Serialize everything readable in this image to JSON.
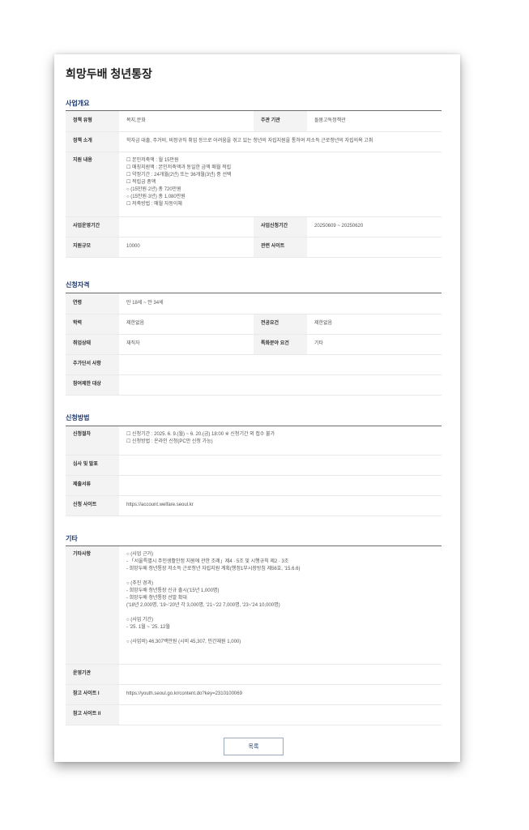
{
  "page_title": "희망두배 청년통장",
  "overview": {
    "heading": "사업개요",
    "policy_type_label": "정책 유형",
    "policy_type_value": "복지,문화",
    "agency_label": "주관 기관",
    "agency_value": "돌봄고독정책관",
    "intro_label": "정책 소개",
    "intro_value": "학자금 대출, 주거비, 비정규직 취업 등으로 어려움을 겪고 있는 청년의 자립지원을 통하여 저소득 근로청년의 자립의욕 고취",
    "support_label": "지원 내용",
    "support_value": "☐ 본인저축액 : 월 15만원\n☐ 매칭지원액 : 본인저축액과 동일한 금액 매월 적립\n☐ 약정기간 : 24개월(2년) 또는 36개월(3년) 중 선택\n☐ 적립금 총액\n○ (15만원·2년) 총 720만원\n○ (15만원·3년) 총 1,080만원\n☐ 저축방법 : 매월 자동이체",
    "op_period_label": "사업운영기간",
    "op_period_value": "",
    "apply_period_label": "사업신청기간",
    "apply_period_value": "20250609 ~ 20250620",
    "scale_label": "지원규모",
    "scale_value": "10000",
    "site_label": "관련 사이트",
    "site_value": ""
  },
  "eligibility": {
    "heading": "신청자격",
    "age_label": "연령",
    "age_value": "만 18세 ~ 만 34세",
    "edu_label": "학력",
    "edu_value": "제한없음",
    "major_label": "전공요건",
    "major_value": "제한없음",
    "job_label": "취업상태",
    "job_value": "재직자",
    "special_label": "특화분야 요건",
    "special_value": "기타",
    "extra_label": "추가단서 사항",
    "extra_value": "",
    "limit_label": "참여제한 대상",
    "limit_value": ""
  },
  "apply_method": {
    "heading": "신청방법",
    "procedure_label": "신청절차",
    "procedure_value": "☐ 신청기간 : 2025. 6. 9.(월) ~ 6. 20.(금) 18:00 ※ 신청기간 외 접수 불가\n☐ 신청방법 : 온라인 신청(PC만 신청 가능)",
    "review_label": "심사 및 발표",
    "review_value": "",
    "docs_label": "제출서류",
    "docs_value": "",
    "site_label": "신청 사이트",
    "site_value": "https://account.welfare.seoul.kr"
  },
  "etc": {
    "heading": "기타",
    "notes_label": "기타사항",
    "notes_value": "○ (사업 근거)\n- 「서울특별시 주민생활안정 지원에 관한 조례」제4 · 5조 및 시행규칙 제2 · 3조\n- 희망두배 청년통장 저소득 근로청년 자립지원 계획(행정1부시장방침 제56호, '15.6.6)\n\n○ (추진 경과)\n- 희망두배 청년통장 신규 출시('15년 1,000명)\n- 희망두배 청년통장 선발 확대\n('18년 2,000명, '19~'20년 각 3,000명, '21~'22 7,000명, '23~'24 10,000명)\n\n○ (사업 기간)\n- '25. 1월 ~ '25. 12월\n\n○ (사업비) 46,307백만원 (시비 45,307, 민간재원 1,000)",
    "operator_label": "운영기관",
    "operator_value": "",
    "ref1_label": "참고 사이트 I",
    "ref1_value": "https://youth.seoul.go.kr/content.do?key=2310100069",
    "ref2_label": "참고 사이트 II",
    "ref2_value": ""
  },
  "list_button_label": "목록"
}
